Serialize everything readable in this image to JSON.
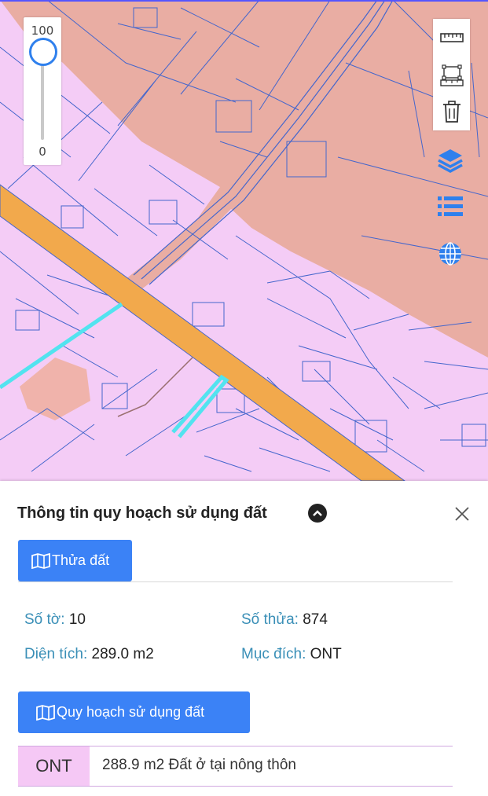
{
  "map": {
    "colors": {
      "residential": "#f4ccf6",
      "commercial": "#e9ada3",
      "road": "#f2a94c",
      "boundary": "#4466cc",
      "selected": "#52e3ef"
    }
  },
  "opacity_slider": {
    "max_label": "100",
    "min_label": "0",
    "value": 100
  },
  "tools": {
    "icons": [
      "ruler-icon",
      "area-measure-icon",
      "trash-icon",
      "layers-icon",
      "list-icon",
      "globe-icon"
    ]
  },
  "panel": {
    "title": "Thông tin quy hoạch sử dụng đất",
    "parcel_tab": "Thửa đất",
    "sheet_label": "Số tờ:",
    "sheet_value": "10",
    "parcel_label": "Số thửa:",
    "parcel_value": "874",
    "area_label": "Diện tích:",
    "area_value": "289.0 m2",
    "purpose_label": "Mục đích:",
    "purpose_value": "ONT",
    "plan_tab": "Quy hoạch sử dụng đất",
    "plan_rows": [
      {
        "code": "ONT",
        "description": "288.9 m2 Đất ở tại nông thôn"
      }
    ]
  }
}
